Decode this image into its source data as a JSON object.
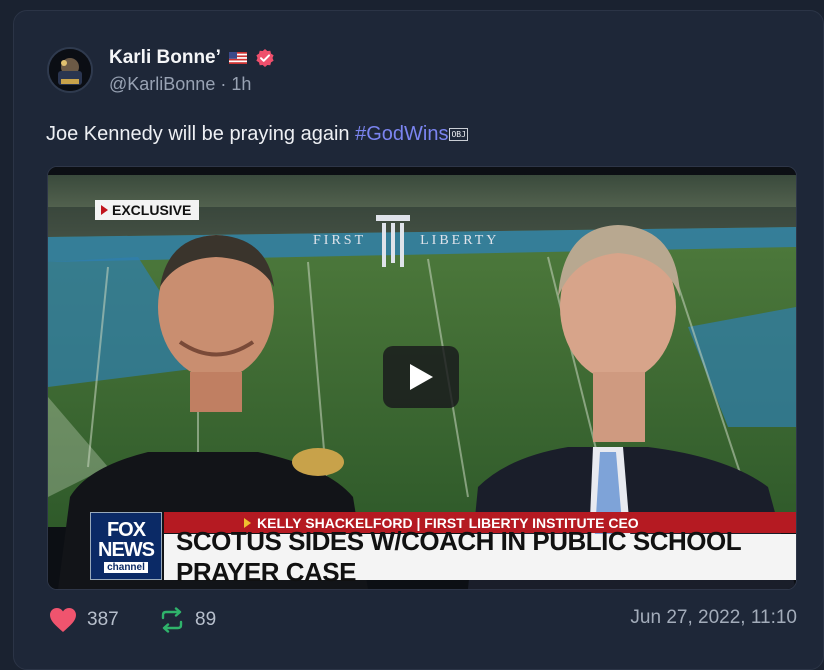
{
  "author": {
    "display_name": "Karli Bonne’",
    "handle_line": "@KarliBonne · 1h"
  },
  "post": {
    "text": "Joe Kennedy will be praying again ",
    "hashtag": "#GodWins",
    "obj_glyph": "OBJ"
  },
  "video": {
    "exclusive_label": "EXCLUSIVE",
    "logo_text_left": "FIRST",
    "logo_text_right": "LIBERTY",
    "fox_line1": "FOX",
    "fox_line2": "NEWS",
    "fox_line3": "channel",
    "name_bar": "KELLY SHACKELFORD | FIRST LIBERTY INSTITUTE CEO",
    "headline": "SCOTUS SIDES W/COACH IN PUBLIC SCHOOL PRAYER CASE"
  },
  "stats": {
    "likes": "387",
    "reposts": "89",
    "timestamp": "Jun 27, 2022, 11:10"
  },
  "colors": {
    "background": "#1a2230",
    "card": "#1e2738",
    "hashtag": "#7b84f0",
    "like": "#f0546e",
    "repost": "#2fb36b",
    "verified": "#ef4f6c"
  }
}
